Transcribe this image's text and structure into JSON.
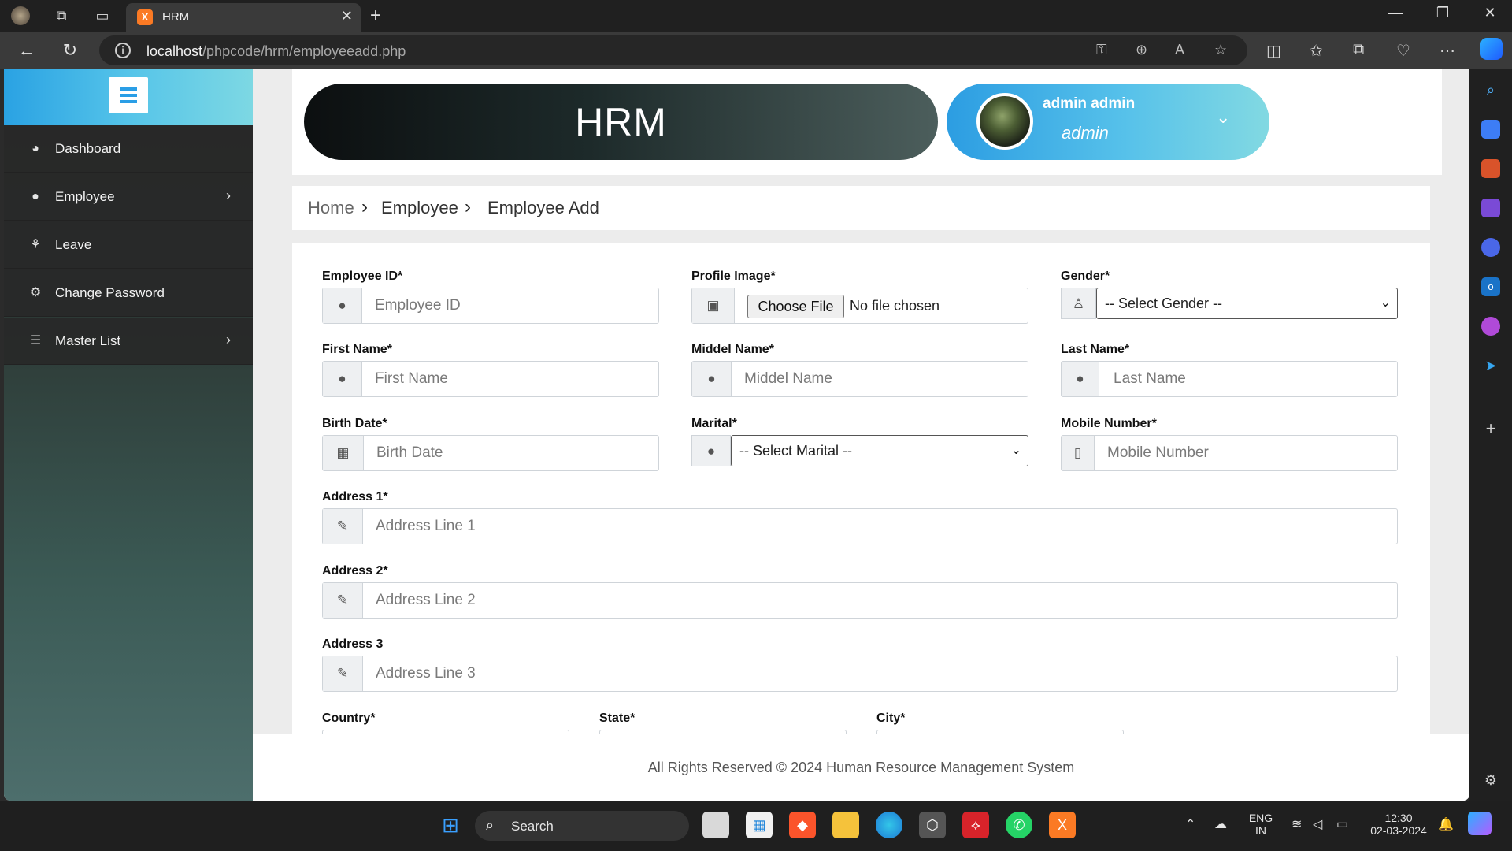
{
  "browser": {
    "tab_title": "HRM",
    "tab_favicon_letter": "X",
    "url_host": "localhost",
    "url_path": "/phpcode/hrm/employeeadd.php",
    "accent": "#fb7a24"
  },
  "sidebar": {
    "items": [
      {
        "label": "Dashboard",
        "icon": "dashboard-icon",
        "has_submenu": false
      },
      {
        "label": "Employee",
        "icon": "user-icon",
        "has_submenu": true
      },
      {
        "label": "Leave",
        "icon": "leave-icon",
        "has_submenu": false
      },
      {
        "label": "Change Password",
        "icon": "gears-icon",
        "has_submenu": false
      },
      {
        "label": "Master List",
        "icon": "list-icon",
        "has_submenu": true
      }
    ]
  },
  "header": {
    "title": "HRM",
    "user_name": "admin admin",
    "user_role": "admin"
  },
  "breadcrumb": {
    "items": [
      "Home",
      "Employee",
      "Employee Add"
    ]
  },
  "form": {
    "employee_id": {
      "label": "Employee ID*",
      "placeholder": "Employee ID"
    },
    "profile_image": {
      "label": "Profile Image*",
      "button": "Choose File",
      "status": "No file chosen"
    },
    "gender": {
      "label": "Gender*",
      "selected": "-- Select Gender --"
    },
    "first_name": {
      "label": "First Name*",
      "placeholder": "First Name"
    },
    "middle_name": {
      "label": "Middel Name*",
      "placeholder": "Middel Name"
    },
    "last_name": {
      "label": "Last Name*",
      "placeholder": "Last Name"
    },
    "birth_date": {
      "label": "Birth Date*",
      "placeholder": "Birth Date"
    },
    "marital": {
      "label": "Marital*",
      "selected": "-- Select Marital --"
    },
    "mobile": {
      "label": "Mobile Number*",
      "placeholder": "Mobile Number"
    },
    "address1": {
      "label": "Address 1*",
      "placeholder": "Address Line 1"
    },
    "address2": {
      "label": "Address 2*",
      "placeholder": "Address Line 2"
    },
    "address3": {
      "label": "Address 3",
      "placeholder": "Address Line 3"
    },
    "country": {
      "label": "Country*"
    },
    "state": {
      "label": "State*"
    },
    "city": {
      "label": "City*"
    }
  },
  "footer": {
    "text": "All Rights Reserved © 2024 Human Resource Management System"
  },
  "taskbar": {
    "search_label": "Search",
    "language_top": "ENG",
    "language_bottom": "IN",
    "time": "12:30",
    "date": "02-03-2024"
  }
}
